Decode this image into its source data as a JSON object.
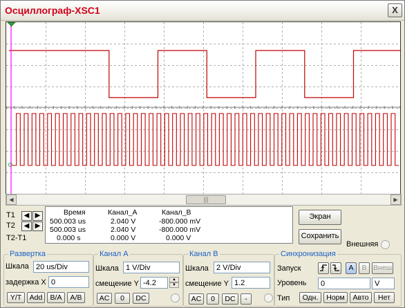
{
  "window": {
    "title": "Осциллограф-XSC1",
    "close_label": "X"
  },
  "scope": {
    "channel_a": {
      "name": "Канал_A",
      "color": "#c00000",
      "waveform": "square",
      "high": 2.04,
      "low": 0,
      "rising_edges": [
        0,
        140,
        280,
        420
      ],
      "falling_edges": [
        70,
        210,
        350,
        490
      ]
    },
    "channel_b": {
      "name": "Канал_B",
      "color": "#c00000",
      "waveform": "square",
      "high": 0.8,
      "low": -0.8,
      "period": 10
    },
    "cursor_t1_color": "#ff00ff",
    "grid": true
  },
  "cursors": {
    "t1_label": "T1",
    "t2_label": "T2",
    "diff_label": "T2-T1"
  },
  "measurements": {
    "headers": [
      "Время",
      "Канал_A",
      "Канал_B"
    ],
    "rows": [
      [
        "500.003 us",
        "2.040 V",
        "-800.000 mV"
      ],
      [
        "500.003 us",
        "2.040 V",
        "-800.000 mV"
      ],
      [
        "0.000 s",
        "0.000 V",
        "0.000 V"
      ]
    ]
  },
  "buttons": {
    "screen": "Экран",
    "save": "Сохранить",
    "external": "Внешняя"
  },
  "timebase": {
    "legend": "Развертка",
    "scale_label": "Шкала",
    "scale_value": "20 us/Div",
    "delay_label": "задержка X",
    "delay_value": "0",
    "modes": [
      "Y/T",
      "Add",
      "B/A",
      "A/B"
    ]
  },
  "channel_a": {
    "legend": "Канал A",
    "scale_label": "Шкала",
    "scale_value": "1  V/Div",
    "offset_label": "смещение Y",
    "offset_value": "-4.2",
    "coupling": [
      "AC",
      "0",
      "DC"
    ]
  },
  "channel_b": {
    "legend": "Канал B",
    "scale_label": "Шкала",
    "scale_value": "2  V/Div",
    "offset_label": "смещение Y",
    "offset_value": "1.2",
    "coupling": [
      "AC",
      "0",
      "DC",
      "-"
    ]
  },
  "trigger": {
    "legend": "Синхронизация",
    "edge_label": "Запуск",
    "sources": [
      "A",
      "B",
      "Внеш"
    ],
    "level_label": "Уровень",
    "level_value": "0",
    "level_unit": "V",
    "type_label": "Тип",
    "types": [
      "Одн.",
      "Норм",
      "Авто",
      "Нет"
    ]
  }
}
